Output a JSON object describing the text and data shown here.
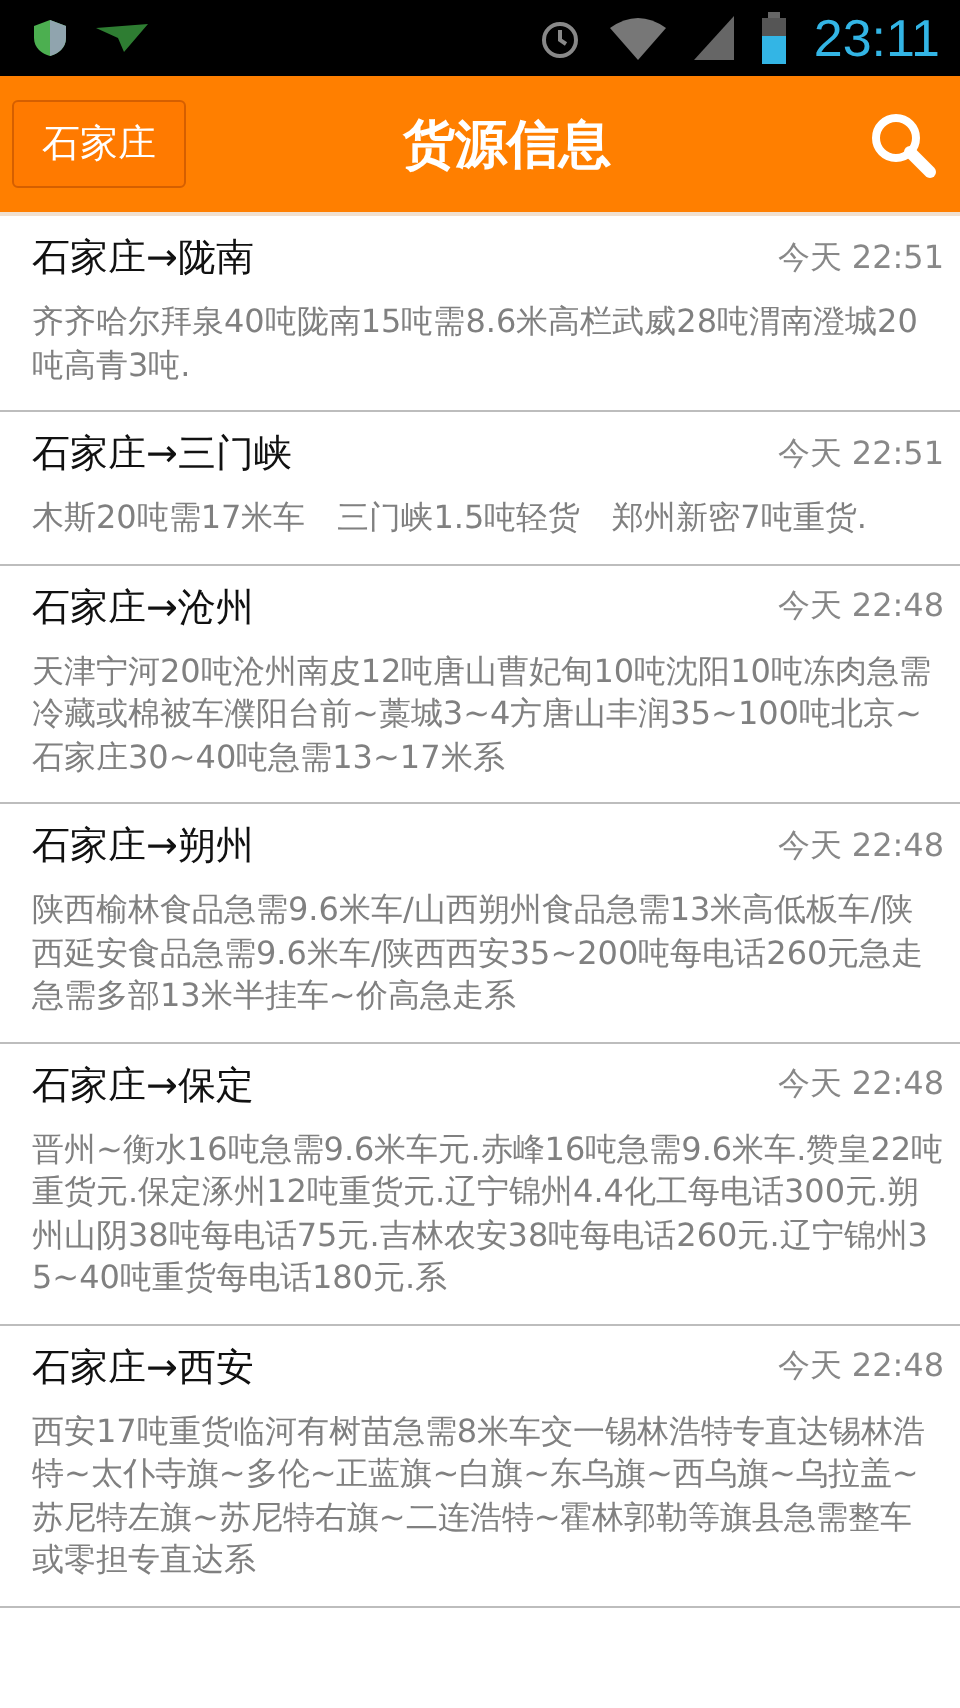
{
  "status_bar": {
    "time": "23:11"
  },
  "header": {
    "city_button": "石家庄",
    "title": "货源信息"
  },
  "listings": [
    {
      "route": "石家庄→陇南",
      "time": "今天 22:51",
      "details": "齐齐哈尔拜泉40吨陇南15吨需8.6米高栏武威28吨渭南澄城20吨高青3吨."
    },
    {
      "route": "石家庄→三门峡",
      "time": "今天 22:51",
      "details": "木斯20吨需17米车　三门峡1.5吨轻货　郑州新密7吨重货."
    },
    {
      "route": "石家庄→沧州",
      "time": "今天 22:48",
      "details": "天津宁河20吨沧州南皮12吨唐山曹妃甸10吨沈阳10吨冻肉急需冷藏或棉被车濮阳台前~藁城3~4方唐山丰润35~100吨北京~石家庄30~40吨急需13~17米系"
    },
    {
      "route": "石家庄→朔州",
      "time": "今天 22:48",
      "details": "陕西榆林食品急需9.6米车/山西朔州食品急需13米高低板车/陕西延安食品急需9.6米车/陕西西安35~200吨每电话260元急走急需多部13米半挂车~价高急走系"
    },
    {
      "route": "石家庄→保定",
      "time": "今天 22:48",
      "details": "晋州~衡水16吨急需9.6米车元.赤峰16吨急需9.6米车.赞皇22吨重货元.保定涿州12吨重货元.辽宁锦州4.4化工每电话300元.朔州山阴38吨每电话75元.吉林农安38吨每电话260元.辽宁锦州35~40吨重货每电话180元.系"
    },
    {
      "route": "石家庄→西安",
      "time": "今天 22:48",
      "details": "西安17吨重货临河有树苗急需8米车交一锡林浩特专直达锡林浩特~太仆寺旗~多伦~正蓝旗~白旗~东乌旗~西乌旗~乌拉盖~苏尼特左旗~苏尼特右旗~二连浩特~霍林郭勒等旗县急需整车或零担专直达系"
    }
  ]
}
